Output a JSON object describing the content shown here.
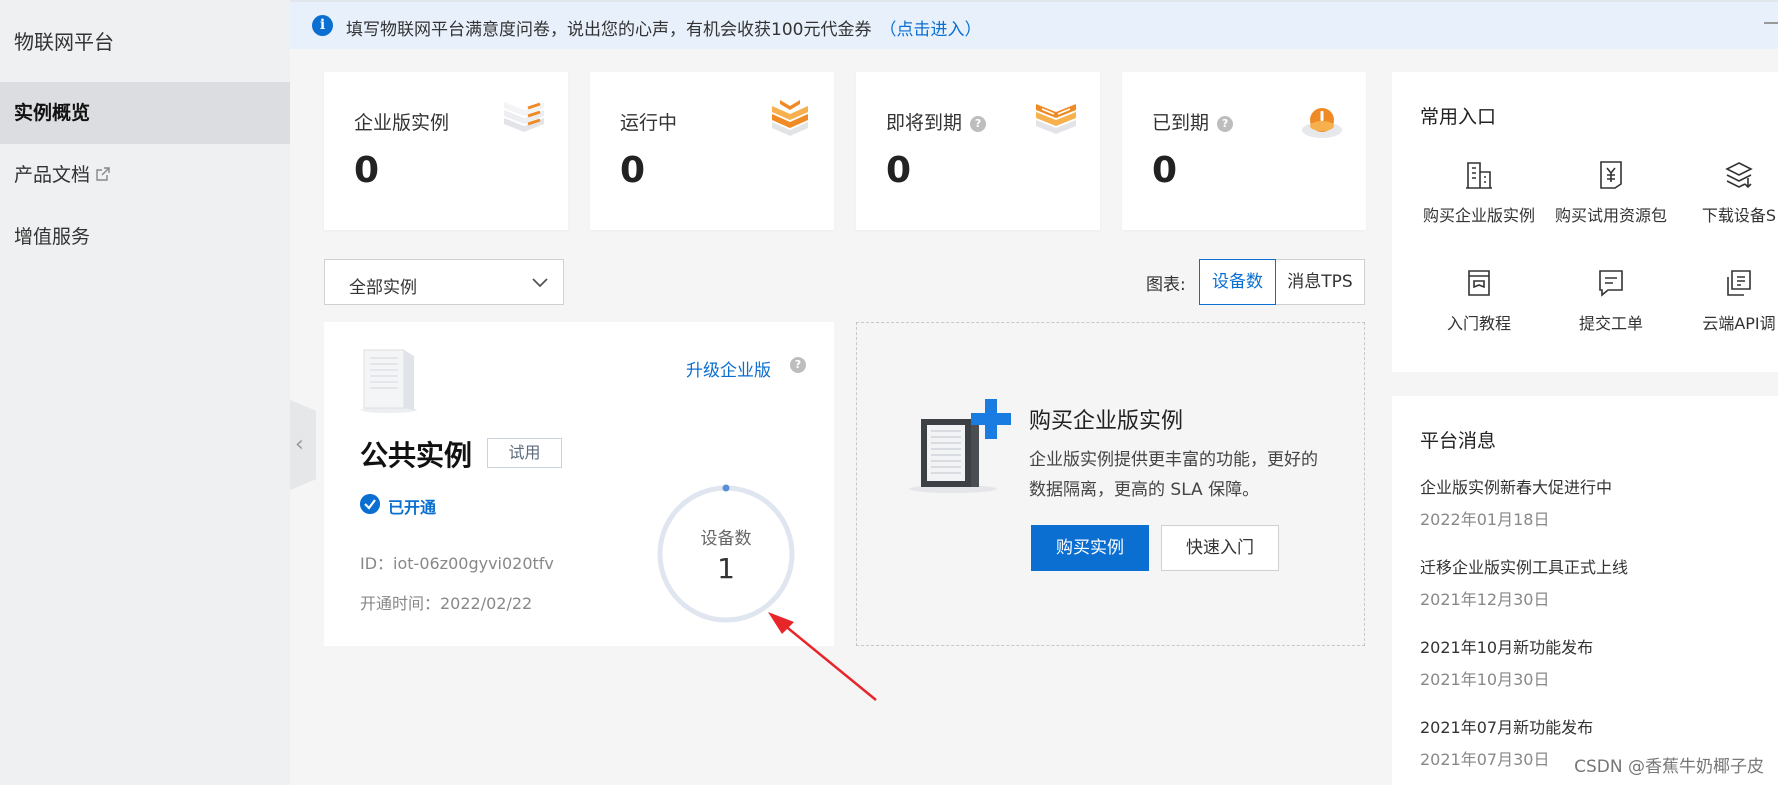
{
  "sidebar": {
    "title": "物联网平台",
    "items": [
      {
        "label": "实例概览",
        "active": true
      },
      {
        "label": "产品文档",
        "external": true
      },
      {
        "label": "增值服务"
      }
    ],
    "collapse_glyph": "‹"
  },
  "banner": {
    "icon": "info-icon",
    "icon_glyph": "i",
    "text": "填写物联网平台满意度问卷，说出您的心声，有机会收获100元代金券",
    "link": "（点击进入）"
  },
  "stats": [
    {
      "label": "企业版实例",
      "value": "0",
      "help": false,
      "icon": "enterprise-instance-icon"
    },
    {
      "label": "运行中",
      "value": "0",
      "help": false,
      "icon": "running-icon"
    },
    {
      "label": "即将到期",
      "value": "0",
      "help": true,
      "icon": "expiring-icon"
    },
    {
      "label": "已到期",
      "value": "0",
      "help": true,
      "icon": "expired-icon"
    }
  ],
  "help_glyph": "?",
  "filter": {
    "selected": "全部实例",
    "chart_label": "图表:",
    "tabs": [
      {
        "label": "设备数",
        "active": true
      },
      {
        "label": "消息TPS",
        "active": false
      }
    ]
  },
  "instance": {
    "upgrade_label": "升级企业版",
    "name": "公共实例",
    "tag": "试用",
    "status": "已开通",
    "id_text": "ID：iot-06z00gyvi020tfv",
    "date_text": "开通时间：2022/02/22",
    "metric_label": "设备数",
    "metric_value": "1"
  },
  "buy": {
    "title": "购买企业版实例",
    "description": "企业版实例提供更丰富的功能，更好的数据隔离，更高的 SLA 保障。",
    "primary_button": "购买实例",
    "secondary_button": "快速入门"
  },
  "quick_access": {
    "title": "常用入口",
    "items": [
      {
        "label": "购买企业版实例",
        "icon": "building-icon"
      },
      {
        "label": "购买试用资源包",
        "icon": "yuan-document-icon"
      },
      {
        "label": "下载设备S",
        "icon": "layers-download-icon"
      },
      {
        "label": "入门教程",
        "icon": "book-icon"
      },
      {
        "label": "提交工单",
        "icon": "ticket-icon"
      },
      {
        "label": "云端API调",
        "icon": "api-icon"
      }
    ]
  },
  "messages": {
    "title": "平台消息",
    "items": [
      {
        "title": "企业版实例新春大促进行中",
        "date": "2022年01月18日"
      },
      {
        "title": "迁移企业版实例工具正式上线",
        "date": "2021年12月30日"
      },
      {
        "title": "2021年10月新功能发布",
        "date": "2021年10月30日"
      },
      {
        "title": "2021年07月新功能发布",
        "date": "2021年07月30日"
      }
    ]
  },
  "watermark": "CSDN @香蕉牛奶椰子皮",
  "colors": {
    "accent": "#0a6fd1",
    "orange": "#f08a24",
    "sidebar_bg": "#eef0f2"
  }
}
